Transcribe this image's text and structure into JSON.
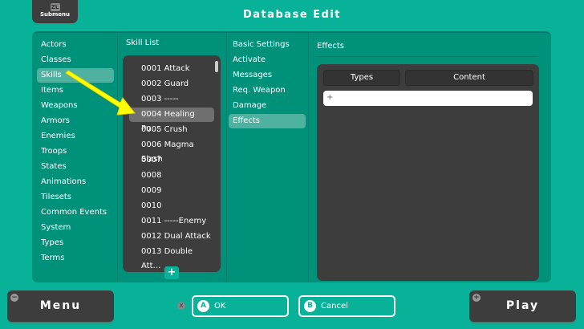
{
  "header": {
    "submenu_key": "ZL",
    "submenu_label": "Submenu",
    "title": "Database Edit"
  },
  "categories": [
    "Actors",
    "Classes",
    "Skills",
    "Items",
    "Weapons",
    "Armors",
    "Enemies",
    "Troops",
    "States",
    "Animations",
    "Tilesets",
    "Common Events",
    "System",
    "Types",
    "Terms"
  ],
  "selected_category": "Skills",
  "skill_list": {
    "title": "Skill List",
    "items": [
      "0001 Attack",
      "0002 Guard",
      "0003 -----Reserved",
      "0004 Healing Pu…",
      "0005 Crush",
      "0006 Magma Slash",
      "0007",
      "0008",
      "0009",
      "0010",
      "0011 -----Enemy",
      "0012 Dual Attack",
      "0013 Double Att…"
    ],
    "selected": "0004 Healing Pu…",
    "add_label": "+"
  },
  "settings": {
    "items": [
      "Basic Settings",
      "Activate",
      "Messages",
      "Req. Weapon",
      "Damage",
      "Effects"
    ],
    "selected": "Effects"
  },
  "effects": {
    "title": "Effects",
    "col_types": "Types",
    "col_content": "Content",
    "add_row": "+"
  },
  "footer": {
    "menu_key": "−",
    "menu": "Menu",
    "x_key": "X",
    "ok_key": "A",
    "ok": "OK",
    "cancel_key": "B",
    "cancel": "Cancel",
    "play_key": "+",
    "play": "Play"
  },
  "colors": {
    "background": "#07b299",
    "panel": "#00917b",
    "dark": "#3d3d3d",
    "annotation_arrow": "#ffff00"
  }
}
